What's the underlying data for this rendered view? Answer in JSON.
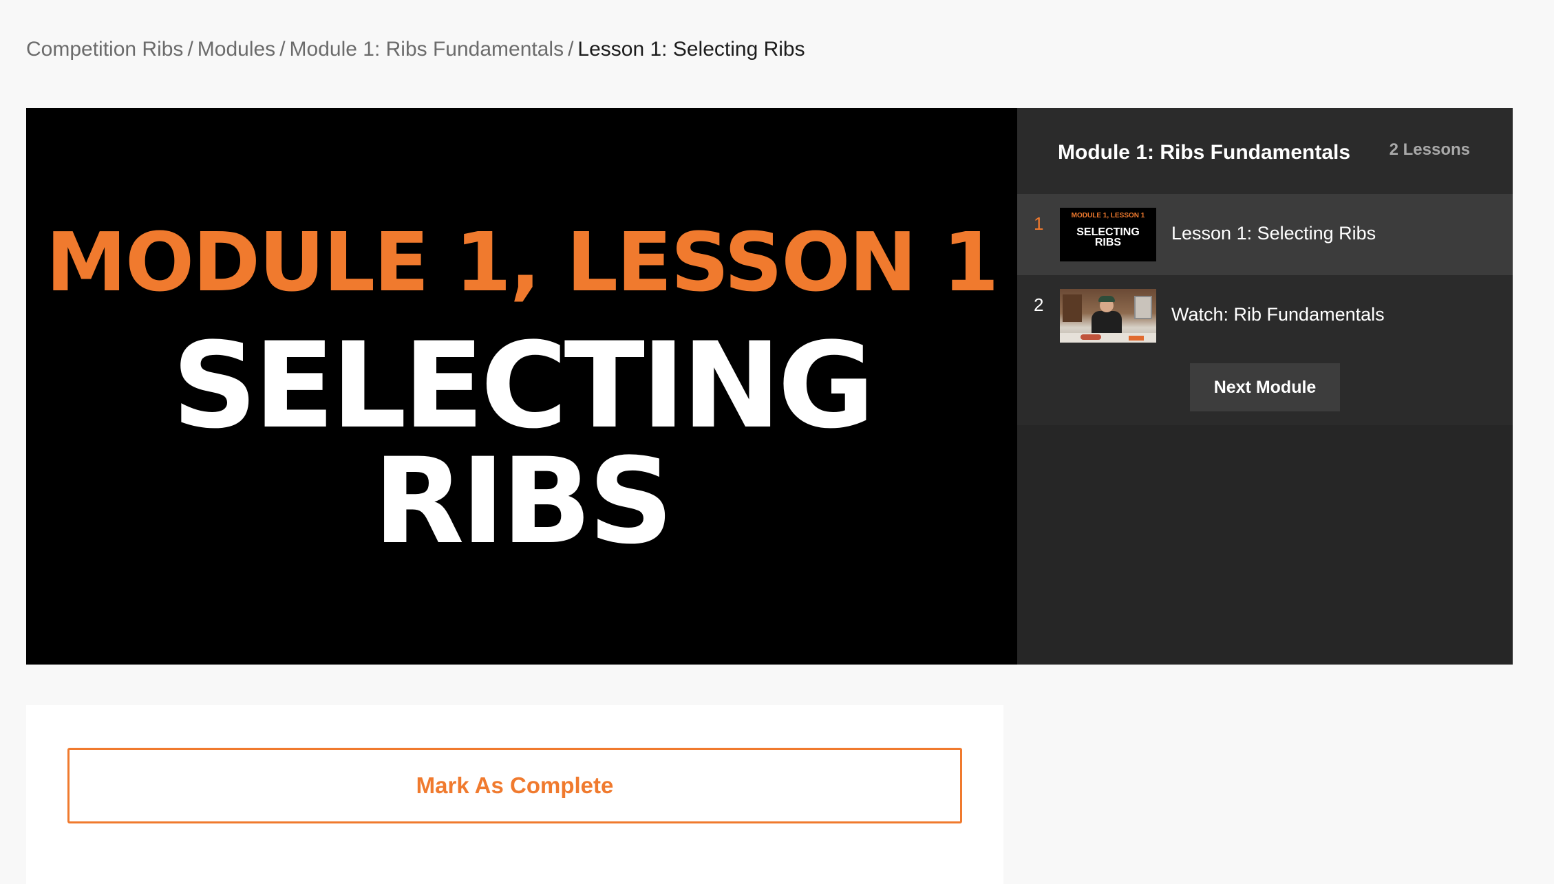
{
  "breadcrumb": {
    "items": [
      "Competition Ribs",
      "Modules",
      "Module 1: Ribs Fundamentals"
    ],
    "separator": "/",
    "current": "Lesson 1: Selecting Ribs"
  },
  "video": {
    "kicker": "MODULE 1, LESSON 1",
    "title_line1": "SELECTING",
    "title_line2": "RIBS"
  },
  "sidebar": {
    "module_title": "Module 1: Ribs Fundamentals",
    "lesson_count": "2 Lessons",
    "lessons": [
      {
        "number": "1",
        "label": "Lesson 1: Selecting Ribs",
        "thumb_kicker": "MODULE 1, LESSON 1",
        "thumb_title_1": "SELECTING",
        "thumb_title_2": "RIBS",
        "active": true
      },
      {
        "number": "2",
        "label": "Watch: Rib Fundamentals",
        "active": false
      }
    ],
    "next_button": "Next Module"
  },
  "content": {
    "complete_button": "Mark As Complete"
  },
  "colors": {
    "accent": "#f07a2e",
    "sidebar_bg": "#262626",
    "active_row": "#3c3c3c"
  }
}
